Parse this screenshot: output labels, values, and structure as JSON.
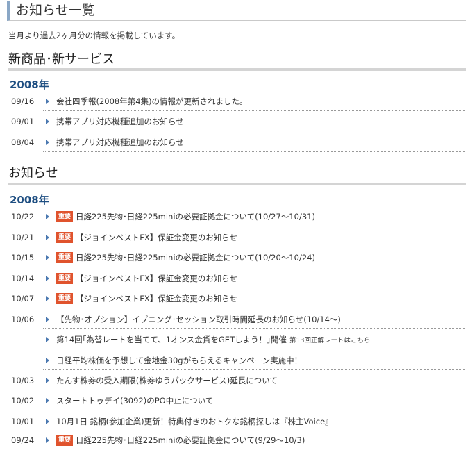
{
  "page_title": "お知らせ一覧",
  "intro": "当月より過去2ヶ月分の情報を掲載しています。",
  "section1": {
    "title": "新商品･新サービス",
    "year": "2008年",
    "items": [
      {
        "date": "09/16",
        "label": "会社四季報(2008年第4集)の情報が更新されました。"
      },
      {
        "date": "09/01",
        "label": "携帯アプリ対応機種追加のお知らせ"
      },
      {
        "date": "08/04",
        "label": "携帯アプリ対応機種追加のお知らせ"
      }
    ]
  },
  "section2": {
    "title": "お知らせ",
    "year": "2008年",
    "badge": "重要",
    "items": [
      {
        "date": "10/22",
        "important": true,
        "label": "日経225先物･日経225miniの必要証拠金について(10/27～10/31)"
      },
      {
        "date": "10/21",
        "important": true,
        "label": "【ジョインベストFX】保証金変更のお知らせ"
      },
      {
        "date": "10/15",
        "important": true,
        "label": "日経225先物･日経225miniの必要証拠金について(10/20～10/24)"
      },
      {
        "date": "10/14",
        "important": true,
        "label": "【ジョインベストFX】保証金変更のお知らせ"
      },
      {
        "date": "10/07",
        "important": true,
        "label": "【ジョインベストFX】保証金変更のお知らせ"
      },
      {
        "date": "10/06",
        "important": false,
        "label": "【先物･オプション】イブニング･セッション取引時間延長のお知らせ(10/14～)"
      },
      {
        "date": "",
        "important": false,
        "label": "第14回｢為替レートを当てて、1オンス金貨をGETしよう！｣開催",
        "note": "第13回正解レートはこちら"
      },
      {
        "date": "",
        "important": false,
        "label": "日経平均株価を予想して金地金30gがもらえるキャンペーン実施中！"
      },
      {
        "date": "10/03",
        "important": false,
        "label": "たんす株券の受入期限(株券ゆうパックサービス)延長について"
      },
      {
        "date": "10/02",
        "important": false,
        "label": "スタートトゥデイ(3092)のPO中止について"
      },
      {
        "date": "10/01",
        "important": false,
        "label": "10月1日 銘柄(参加企業)更新！特典付きのおトクな銘柄探しは『株主Voice』"
      },
      {
        "date": "09/24",
        "important": true,
        "label": "日経225先物･日経225miniの必要証拠金について(9/29～10/3)"
      }
    ]
  },
  "colors": {
    "accent_bar": "#8aa7c6",
    "year_text": "#1f4f82",
    "badge_bg": "#e0532d",
    "arrow": "#4a78b0",
    "section_rule": "#d4d4d4"
  }
}
